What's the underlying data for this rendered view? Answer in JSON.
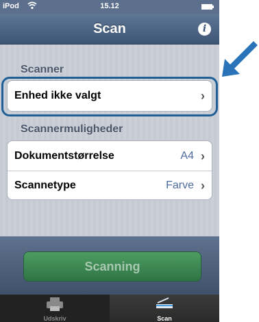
{
  "status_bar": {
    "device": "iPod",
    "time": "15.12"
  },
  "nav": {
    "title": "Scan",
    "info_icon": "info-icon"
  },
  "scanner_section": {
    "header": "Scanner",
    "device_label": "Enhed ikke valgt"
  },
  "options_section": {
    "header": "Scannermuligheder",
    "rows": [
      {
        "label": "Dokumentstørrelse",
        "value": "A4"
      },
      {
        "label": "Scannetype",
        "value": "Farve"
      }
    ]
  },
  "scan_button": {
    "label": "Scanning"
  },
  "tabs": [
    {
      "label": "Udskriv",
      "icon": "printer-icon",
      "selected": false
    },
    {
      "label": "Scan",
      "icon": "scanner-icon",
      "selected": true
    }
  ],
  "colors": {
    "nav": "#4a6080",
    "highlight": "#1f5f96",
    "arrow": "#2a73b8",
    "button": "#3f8a55"
  }
}
